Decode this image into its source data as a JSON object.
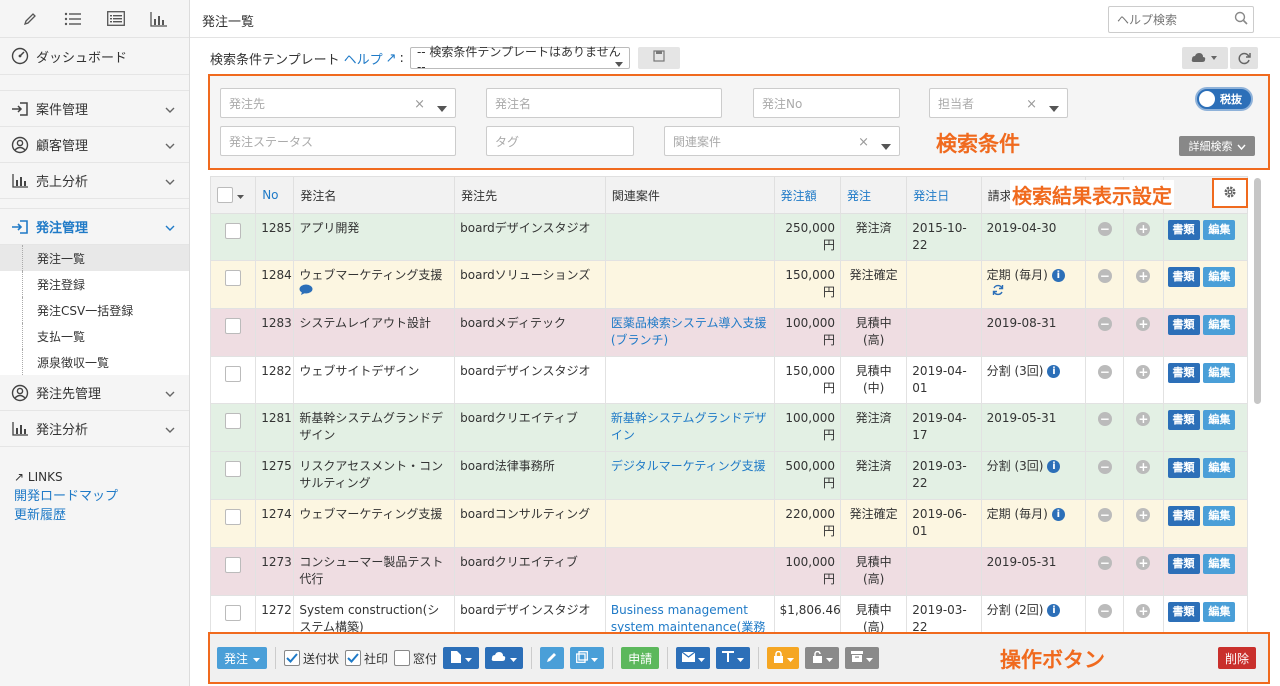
{
  "sidebar": {
    "top_icons": [
      "pencil-icon",
      "list-icon",
      "list-detail-icon",
      "chart-icon"
    ],
    "dashboard": "ダッシュボード",
    "items": [
      {
        "label": "案件管理",
        "icon": "case-icon"
      },
      {
        "label": "顧客管理",
        "icon": "user-icon"
      },
      {
        "label": "売上分析",
        "icon": "chart-icon"
      },
      {
        "label": "発注管理",
        "icon": "order-icon"
      },
      {
        "label": "発注先管理",
        "icon": "user-icon"
      },
      {
        "label": "発注分析",
        "icon": "chart-icon"
      }
    ],
    "sub_items": [
      "発注一覧",
      "発注登録",
      "発注CSV一括登録",
      "支払一覧",
      "源泉徴収一覧"
    ],
    "links_title": "LINKS",
    "links": [
      "開発ロードマップ",
      "更新履歴"
    ]
  },
  "header": {
    "title": "発注一覧",
    "search_placeholder": "ヘルプ検索"
  },
  "template": {
    "label": "検索条件テンプレート",
    "help": "ヘルプ",
    "colon": ":",
    "select": "-- 検索条件テンプレートはありません --"
  },
  "search": {
    "vendor": "発注先",
    "name": "発注名",
    "number": "発注No",
    "owner": "担当者",
    "status": "発注ステータス",
    "tag": "タグ",
    "related": "関連案件",
    "tax_toggle": "税抜",
    "advanced": "詳細検索"
  },
  "annotations": {
    "search_conditions": "検索条件",
    "result_settings": "検索結果表示設定",
    "action_buttons": "操作ボタン"
  },
  "table": {
    "headers": [
      "No",
      "発注名",
      "発注先",
      "関連案件",
      "発注額",
      "発注",
      "発注日",
      "請求"
    ],
    "rows": [
      {
        "no": "1285",
        "name": "アプリ開発",
        "vendor": "boardデザインスタジオ",
        "related": "",
        "amount": "250,000円",
        "status": "発注済",
        "date": "2015-10-22",
        "billing": "2019-04-30",
        "color": "green",
        "info": false
      },
      {
        "no": "1284",
        "name": "ウェブマーケティング支援",
        "vendor": "boardソリューションズ",
        "related": "",
        "amount": "150,000円",
        "status": "発注確定",
        "date": "",
        "billing": "定期 (毎月)",
        "color": "yellow",
        "info": true
      },
      {
        "no": "1283",
        "name": "システムレイアウト設計",
        "vendor": "boardメディテック",
        "related": "医薬品検索システム導入支援(ブランチ)",
        "amount": "100,000円",
        "status": "見積中(高)",
        "date": "",
        "billing": "2019-08-31",
        "color": "pink",
        "info": false
      },
      {
        "no": "1282",
        "name": "ウェブサイトデザイン",
        "vendor": "boardデザインスタジオ",
        "related": "",
        "amount": "150,000円",
        "status": "見積中(中)",
        "date": "2019-04-01",
        "billing": "分割 (3回)",
        "color": "white",
        "info": true
      },
      {
        "no": "1281",
        "name": "新基幹システムグランドデザイン",
        "vendor": "boardクリエイティブ",
        "related": "新基幹システムグランドデザイン",
        "amount": "100,000円",
        "status": "発注済",
        "date": "2019-04-17",
        "billing": "2019-05-31",
        "color": "green",
        "info": false
      },
      {
        "no": "1275",
        "name": "リスクアセスメント・コンサルティング",
        "vendor": "board法律事務所",
        "related": "デジタルマーケティング支援",
        "amount": "500,000円",
        "status": "発注済",
        "date": "2019-03-22",
        "billing": "分割 (3回)",
        "color": "green",
        "info": true
      },
      {
        "no": "1274",
        "name": "ウェブマーケティング支援",
        "vendor": "boardコンサルティング",
        "related": "",
        "amount": "220,000円",
        "status": "発注確定",
        "date": "2019-06-01",
        "billing": "定期 (毎月)",
        "color": "yellow",
        "info": true
      },
      {
        "no": "1273",
        "name": "コンシューマー製品テスト代行",
        "vendor": "boardクリエイティブ",
        "related": "",
        "amount": "100,000円",
        "status": "見積中(高)",
        "date": "",
        "billing": "2019-05-31",
        "color": "pink",
        "info": false
      },
      {
        "no": "1272",
        "name": "System construction(システム構築)",
        "vendor": "boardデザインスタジオ",
        "related": "Business management system maintenance(業務管理システム保守)",
        "amount": "$1,806.46",
        "status": "見積中(高)",
        "date": "2019-03-22",
        "billing": "分割 (2回)",
        "color": "white",
        "info": true
      }
    ],
    "doc_btn": "書類",
    "edit_btn": "編集"
  },
  "actions": {
    "order": "発注",
    "send_letter": "送付状",
    "company_seal": "社印",
    "window": "窓付",
    "apply": "申請",
    "delete": "削除"
  },
  "colors": {
    "accent": "#1f7ac7",
    "annotation": "#f06a1e"
  }
}
